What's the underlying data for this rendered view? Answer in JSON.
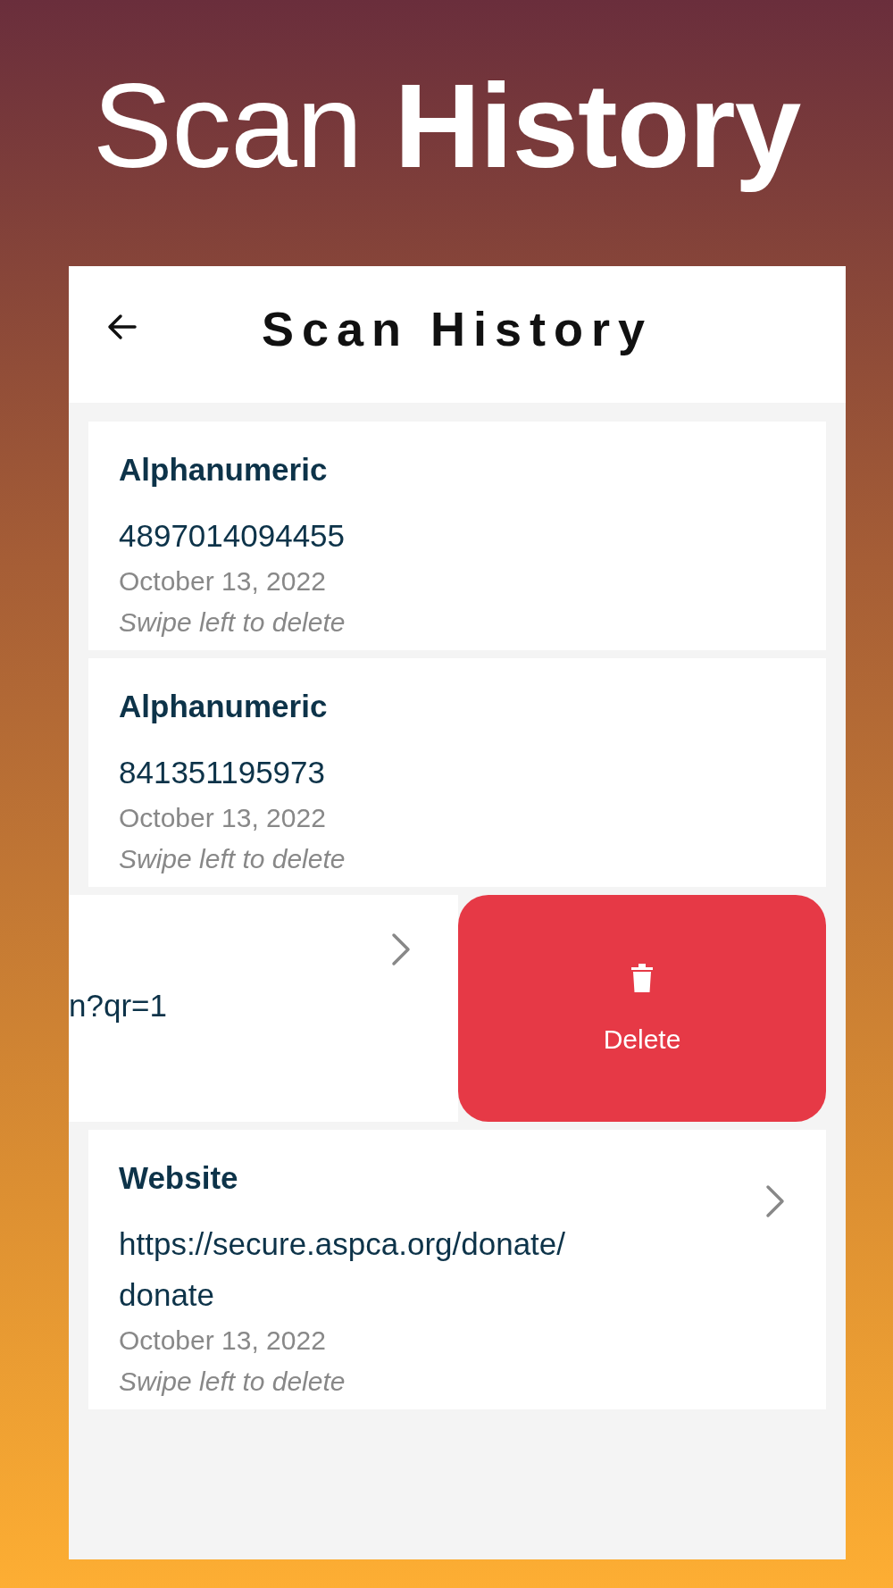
{
  "banner": {
    "title": "Scan **History**"
  },
  "screen": {
    "header": {
      "title": "Scan History"
    },
    "entries": [
      {
        "kind": "card",
        "type": "Alphanumeric",
        "value": "4897014094455",
        "date": "October 13, 2022",
        "hint": "Swipe left to delete",
        "chevron": false
      },
      {
        "kind": "card",
        "type": "Alphanumeric",
        "value": "841351195973",
        "date": "October 13, 2022",
        "hint": "Swipe left to delete",
        "chevron": false
      },
      {
        "kind": "swiped",
        "value": "n?qr=1",
        "chevron": true,
        "action": "Delete"
      },
      {
        "kind": "card",
        "type": "Website",
        "value": "https://secure.aspca.org/donate/donate",
        "date": "October 13, 2022",
        "hint": "Swipe left to delete",
        "chevron": true
      }
    ]
  }
}
